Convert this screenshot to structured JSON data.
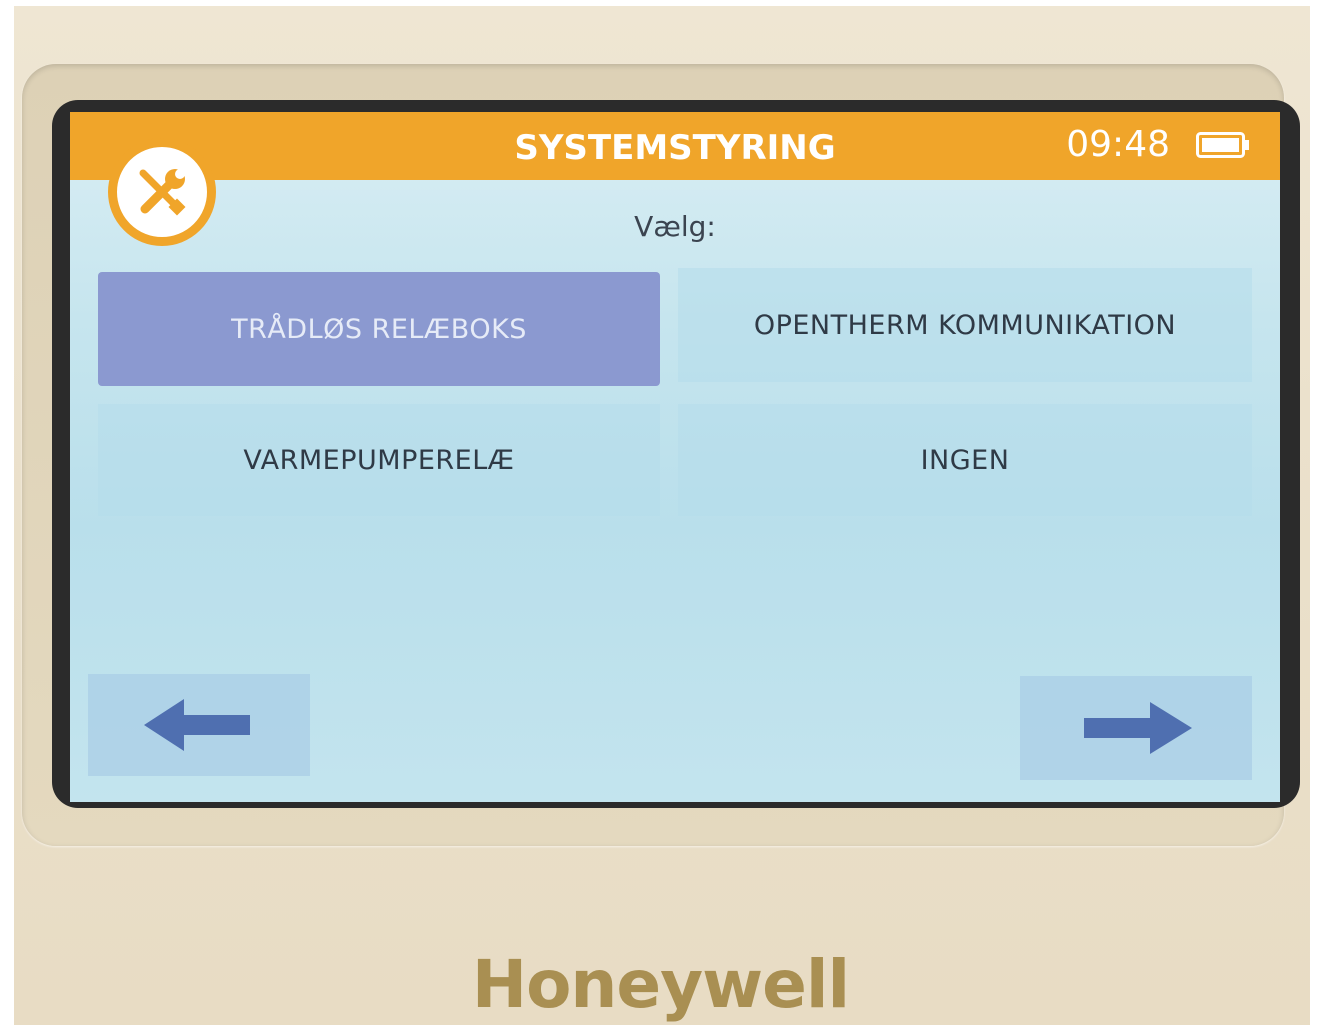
{
  "header": {
    "title": "SYSTEMSTYRING",
    "time": "09:48",
    "battery_icon": "battery-full-icon",
    "tools_icon": "tools-icon",
    "accent_color": "#f0a52a"
  },
  "prompt": "Vælg:",
  "options": [
    {
      "label": "TRÅDLØS RELÆBOKS",
      "selected": true
    },
    {
      "label": "OPENTHERM KOMMUNIKATION",
      "selected": false
    },
    {
      "label": "VARMEPUMPERELÆ",
      "selected": false
    },
    {
      "label": "INGEN",
      "selected": false
    }
  ],
  "navigation": {
    "back_icon": "arrow-left-icon",
    "next_icon": "arrow-right-icon"
  },
  "brand": "Honeywell"
}
